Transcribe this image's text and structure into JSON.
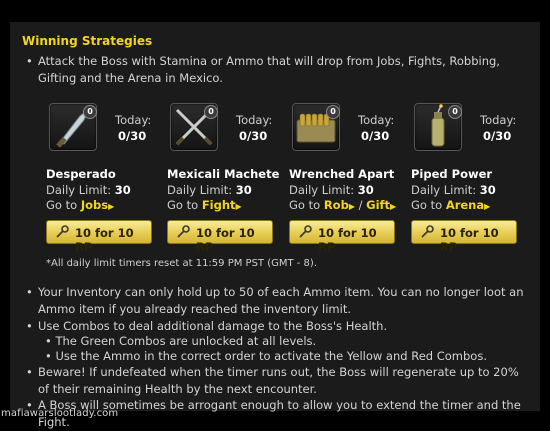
{
  "title": "Winning Strategies",
  "intro": "Attack the Boss with Stamina or Ammo that will drop from Jobs, Fights, Robbing, Gifting and the Arena in Mexico.",
  "items": [
    {
      "count": "0",
      "today_label": "Today:",
      "today": "0/30",
      "name": "Desperado",
      "limit_label": "Daily Limit:",
      "limit": "30",
      "goto_label": "Go to",
      "links": [
        "Jobs"
      ],
      "button": "10 for 10 RP",
      "icon": "knife-icon"
    },
    {
      "count": "0",
      "today_label": "Today:",
      "today": "0/30",
      "name": "Mexicali Machete",
      "limit_label": "Daily Limit:",
      "limit": "30",
      "goto_label": "Go to",
      "links": [
        "Fight"
      ],
      "button": "10 for 10 RP",
      "icon": "crossed-machetes-icon"
    },
    {
      "count": "0",
      "today_label": "Today:",
      "today": "0/30",
      "name": "Wrenched Apart",
      "limit_label": "Daily Limit:",
      "limit": "30",
      "goto_label": "Go to",
      "links": [
        "Rob",
        "Gift"
      ],
      "button": "10 for 10 RP",
      "icon": "ammo-box-icon"
    },
    {
      "count": "0",
      "today_label": "Today:",
      "today": "0/30",
      "name": "Piped Power",
      "limit_label": "Daily Limit:",
      "limit": "30",
      "goto_label": "Go to",
      "links": [
        "Arena"
      ],
      "button": "10 for 10 RP",
      "icon": "pipe-bomb-icon"
    }
  ],
  "link_separator": "/",
  "timer_note": "*All daily limit timers reset at 11:59 PM PST (GMT - 8).",
  "tips": [
    "Your Inventory can only hold up to 50 of each Ammo item. You can no longer loot an Ammo item if you already reached the inventory limit.",
    "Use Combos to deal additional damage to the Boss's Health.",
    "• The Green Combos are unlocked at all levels.",
    "• Use the Ammo in the correct order to activate the Yellow and Red Combos.",
    "Beware! If undefeated when the timer runs out, the Boss will regenerate up to 20% of their remaining Health by the next encounter.",
    "A Boss will sometimes be arrogant enough to allow you to extend the timer and the Fight."
  ],
  "watermark": "mafiawarslootlady.com",
  "colors": {
    "accent": "#f3d51e",
    "panel": "#1b1b1b",
    "button": "#e8cf58"
  }
}
